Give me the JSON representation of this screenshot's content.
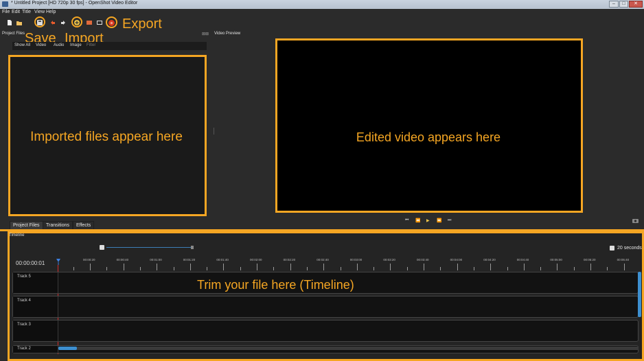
{
  "window": {
    "title": "* Untitled Project [HD 720p 30 fps] - OpenShot Video Editor",
    "controls": [
      "–",
      "□",
      "✕"
    ]
  },
  "menu": [
    "File",
    "Edit",
    "Title",
    "View",
    "Help"
  ],
  "annotations": {
    "save": "Save",
    "import": "Import",
    "export": "Export",
    "files_area": "Imported files appear here",
    "video_area": "Edited video  appears here",
    "timeline_area": "Trim your file here (Timeline)"
  },
  "project_files": {
    "title": "Project Files",
    "filters": [
      "Show All",
      "Video",
      "Audio",
      "Image"
    ],
    "filter_placeholder": "Filter"
  },
  "video_preview": {
    "title": "Video Preview",
    "controls": [
      "⏮",
      "⏪",
      "▶",
      "⏩",
      "⏭"
    ]
  },
  "bottom_tabs": [
    "Project Files",
    "Transitions",
    "Effects"
  ],
  "timeline": {
    "title": "Timeline",
    "zoom_label": "20 seconds",
    "current_time": "00:00:00:01",
    "time_labels": [
      "00:00:20",
      "00:00:40",
      "00:01:00",
      "00:01:20",
      "00:01:40",
      "00:02:00",
      "00:02:20",
      "00:02:40",
      "00:03:00",
      "00:03:20",
      "00:03:40",
      "00:04:00",
      "00:04:20",
      "00:04:40",
      "00:05:00",
      "00:05:20",
      "00:05:40"
    ],
    "tracks": [
      "Track 5",
      "Track 4",
      "Track 3",
      "Track 2"
    ]
  },
  "colors": {
    "accent": "#f5a623",
    "background": "#2b2b2b",
    "playhead": "#d32f2f"
  }
}
